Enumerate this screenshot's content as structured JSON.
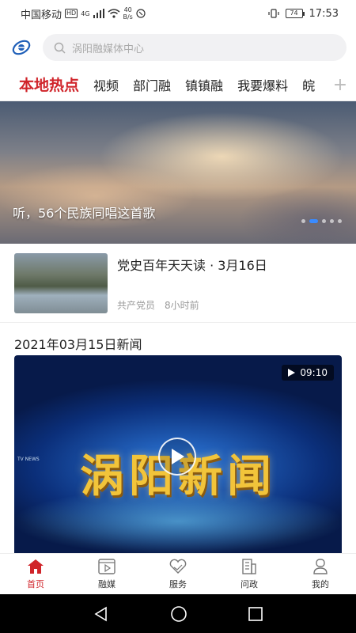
{
  "status_bar": {
    "carrier": "中国移动",
    "hd": "HD",
    "network": "4G",
    "speed_value": "40",
    "speed_unit": "B/s",
    "battery": "74",
    "time": "17:53"
  },
  "header": {
    "search_placeholder": "涡阳融媒体中心"
  },
  "tabs": [
    {
      "label": "本地热点"
    },
    {
      "label": "视频"
    },
    {
      "label": "部门融"
    },
    {
      "label": "镇镇融"
    },
    {
      "label": "我要爆料"
    },
    {
      "label": "皖"
    }
  ],
  "banner": {
    "caption": "听，56个民族同唱这首歌",
    "dots_total": 5,
    "dots_active": 2
  },
  "news_item": {
    "title": "党史百年天天读 · 3月16日",
    "source": "共产党员",
    "time": "8小时前"
  },
  "video_section": {
    "title": "2021年03月15日新闻",
    "duration": "09:10",
    "logo_text": "涡阳新闻",
    "small_text": "TV NEWS"
  },
  "bottom_nav": [
    {
      "label": "首页",
      "icon": "home-icon"
    },
    {
      "label": "融媒",
      "icon": "video-icon"
    },
    {
      "label": "服务",
      "icon": "heart-hands-icon"
    },
    {
      "label": "问政",
      "icon": "building-icon"
    },
    {
      "label": "我的",
      "icon": "user-icon"
    }
  ],
  "colors": {
    "accent": "#d0242a",
    "dot_active": "#3a8bff"
  }
}
